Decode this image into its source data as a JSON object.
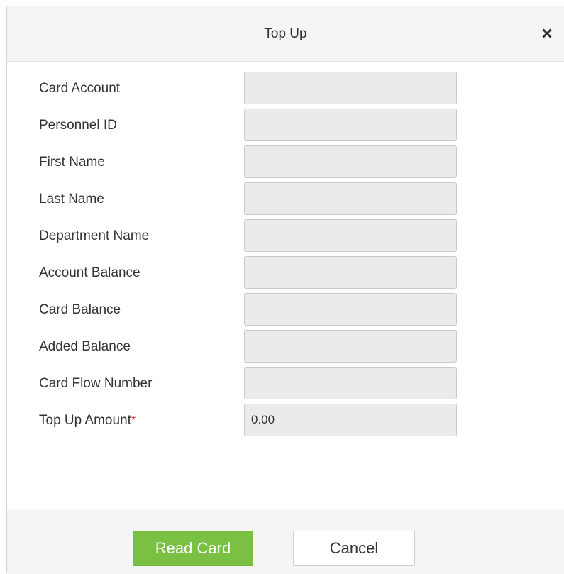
{
  "dialog": {
    "title": "Top Up",
    "close_icon": "close-icon"
  },
  "fields": [
    {
      "label": "Card Account",
      "value": ""
    },
    {
      "label": "Personnel ID",
      "value": ""
    },
    {
      "label": "First Name",
      "value": ""
    },
    {
      "label": "Last Name",
      "value": ""
    },
    {
      "label": "Department Name",
      "value": ""
    },
    {
      "label": "Account Balance",
      "value": ""
    },
    {
      "label": "Card Balance",
      "value": ""
    },
    {
      "label": "Added Balance",
      "value": ""
    },
    {
      "label": "Card Flow Number",
      "value": ""
    },
    {
      "label": "Top Up Amount",
      "required_mark": "*",
      "value": "0.00"
    }
  ],
  "buttons": {
    "read_card": "Read Card",
    "cancel": "Cancel"
  },
  "colors": {
    "primary": "#7ac143",
    "required": "#e02020",
    "input_bg": "#ebebeb",
    "header_bg": "#f4f5f5"
  }
}
